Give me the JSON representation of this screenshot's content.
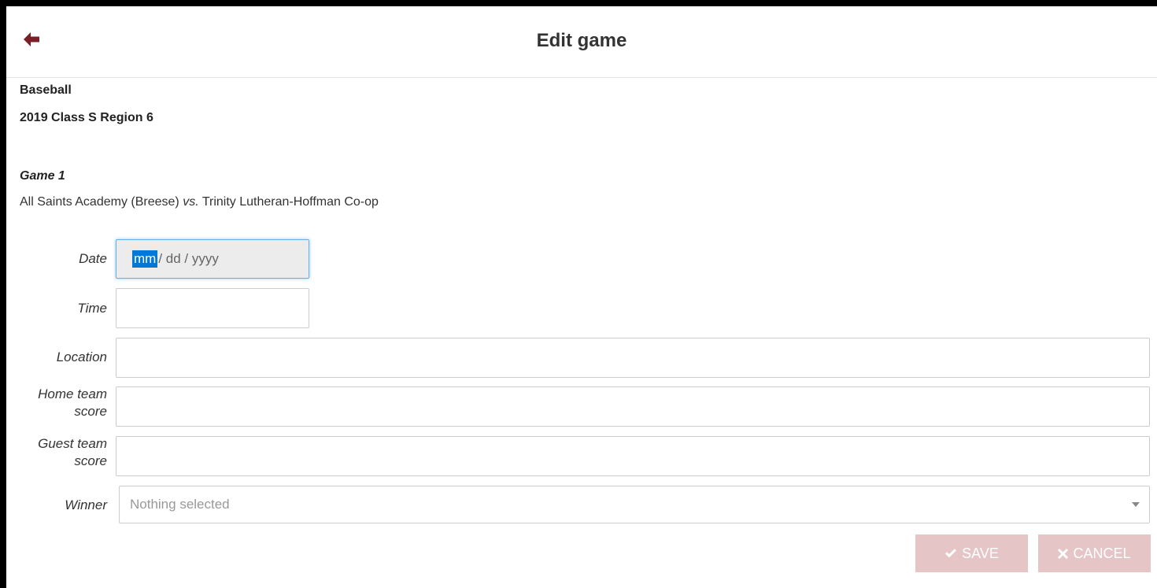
{
  "header": {
    "title": "Edit game",
    "back_icon": "arrow-left-icon",
    "accent": "#7a1f25"
  },
  "context": {
    "sport": "Baseball",
    "tournament": "2019 Class S Region 6",
    "game_label": "Game 1",
    "home_team": "All Saints Academy (Breese)",
    "vs": "vs.",
    "guest_team": "Trinity Lutheran-Hoffman Co-op"
  },
  "form": {
    "date": {
      "label": "Date",
      "segment_selected": "mm",
      "rest": "/ dd / yyyy"
    },
    "time": {
      "label": "Time",
      "value": ""
    },
    "location": {
      "label": "Location",
      "value": ""
    },
    "home_score": {
      "label_line1": "Home team",
      "label_line2": "score",
      "value": ""
    },
    "guest_score": {
      "label_line1": "Guest team",
      "label_line2": "score",
      "value": ""
    },
    "winner": {
      "label": "Winner",
      "placeholder": "Nothing selected",
      "icon": "caret-down-icon"
    }
  },
  "actions": {
    "save_label": "SAVE",
    "save_icon": "check-icon",
    "cancel_label": "CANCEL",
    "cancel_icon": "x-icon",
    "button_color": "#e6c5c7"
  }
}
